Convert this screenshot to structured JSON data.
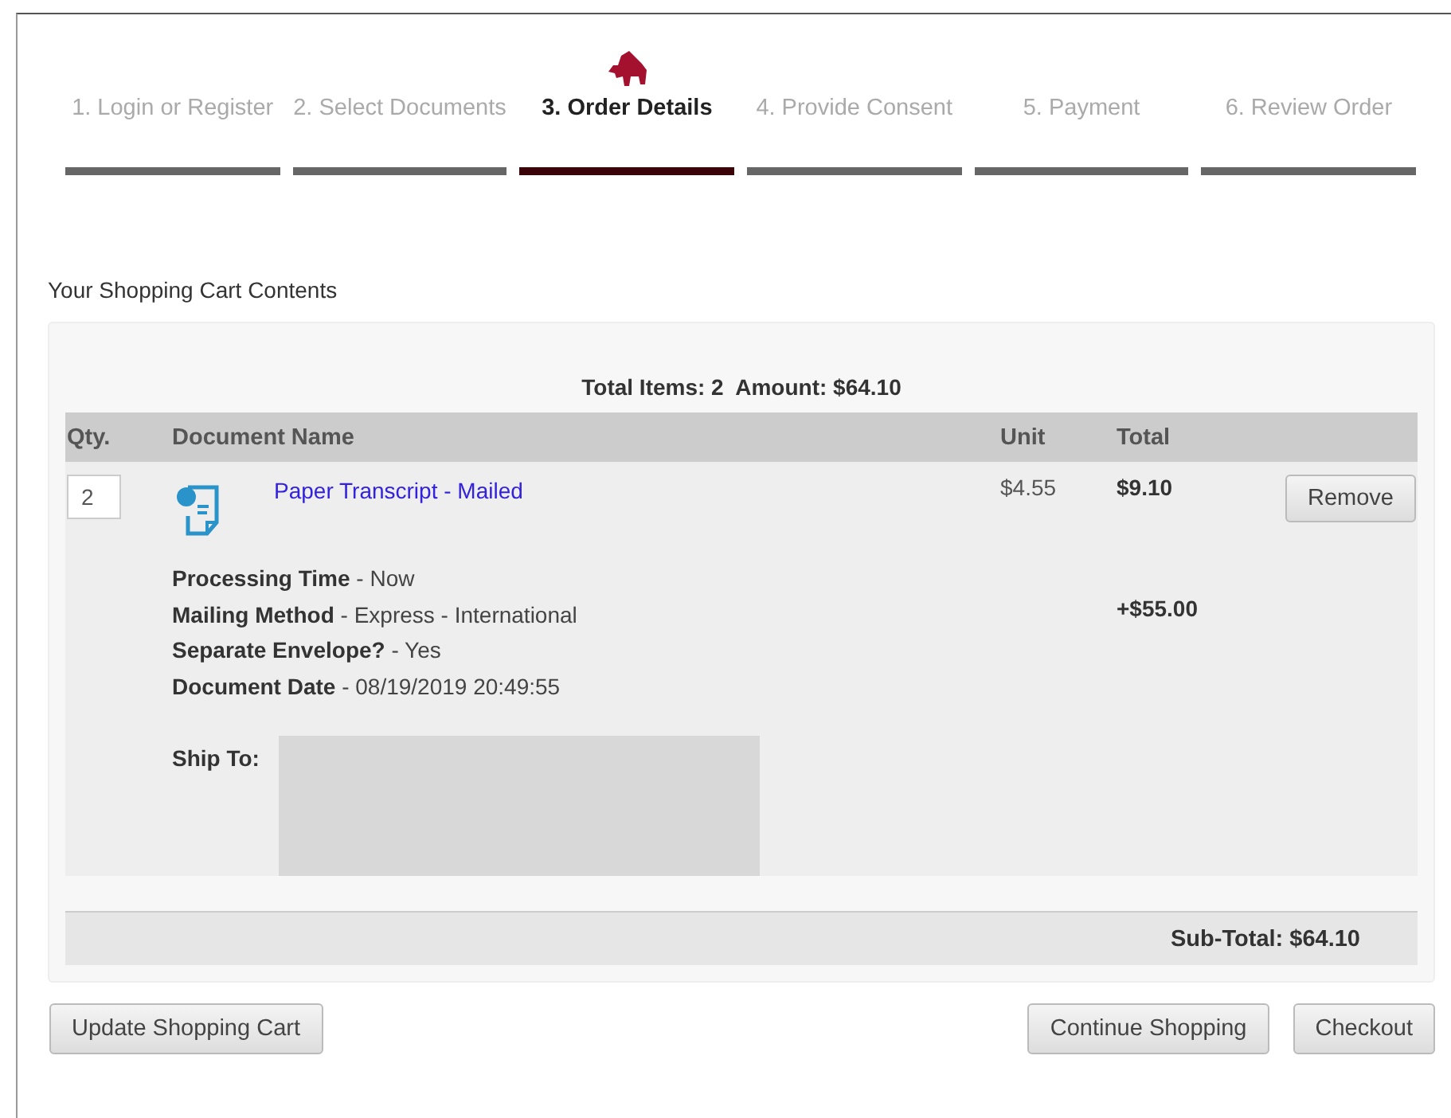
{
  "steps": [
    {
      "label": "1. Login or Register",
      "selected": false
    },
    {
      "label": "2. Select Documents",
      "selected": false
    },
    {
      "label": "3. Order Details",
      "selected": true
    },
    {
      "label": "4. Provide Consent",
      "selected": false
    },
    {
      "label": "5. Payment",
      "selected": false
    },
    {
      "label": "6. Review Order",
      "selected": false
    }
  ],
  "cart": {
    "heading": "Your Shopping Cart Contents",
    "summary": "Total Items: 2  Amount: $64.10",
    "columns": [
      "Qty.",
      "Document Name",
      "Unit",
      "Total"
    ],
    "item": {
      "qty": "2",
      "name": "Paper Transcript - Mailed",
      "unit": "$4.55",
      "total": "$9.10",
      "remove": "Remove",
      "details": [
        "**Processing Time** - Now",
        "**Mailing Method** - Express - International",
        "**Separate Envelope?** - Yes",
        "**Document Date** - 08/19/2019 20:49:55"
      ],
      "extra": "+$55.00",
      "ship_to": "Ship To:"
    },
    "subtotal": "Sub-Total: $64.10"
  },
  "buttons": {
    "left": [
      "Update Shopping Cart"
    ],
    "right": [
      "Continue Shopping",
      "Checkout"
    ]
  }
}
